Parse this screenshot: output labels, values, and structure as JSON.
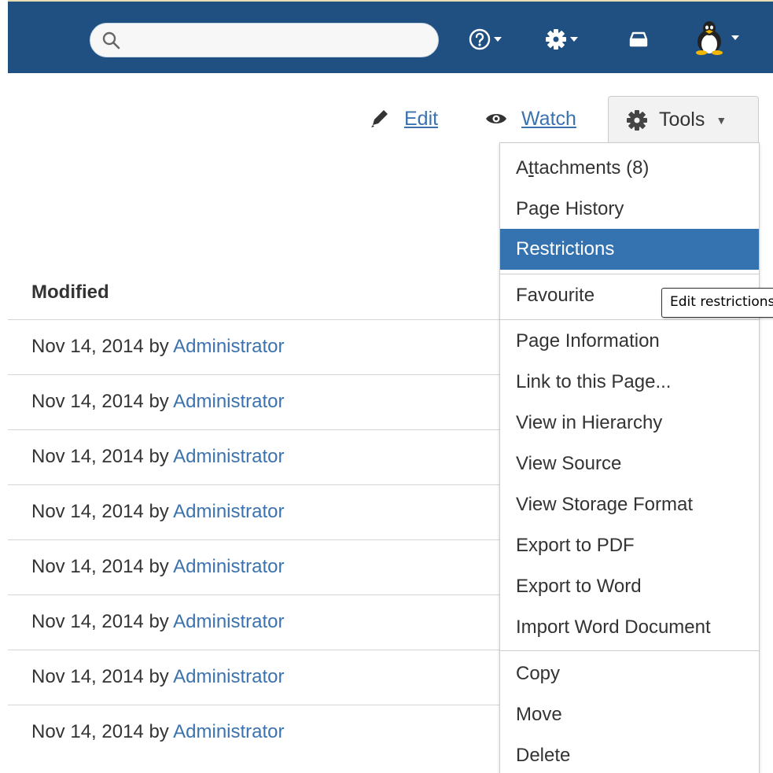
{
  "header": {
    "search": {
      "value": "",
      "placeholder": ""
    },
    "icons": [
      "search-icon",
      "help-icon",
      "gear-icon",
      "inbox-icon",
      "user-avatar-icon"
    ],
    "background": "#205081"
  },
  "toolbar": {
    "edit_label": "Edit",
    "watch_label": "Watch",
    "tools_label": "Tools"
  },
  "table": {
    "header": "Modified",
    "rows": [
      {
        "date": "Nov 14, 2014 by ",
        "author": "Administrator"
      },
      {
        "date": "Nov 14, 2014 by ",
        "author": "Administrator"
      },
      {
        "date": "Nov 14, 2014 by ",
        "author": "Administrator"
      },
      {
        "date": "Nov 14, 2014 by ",
        "author": "Administrator"
      },
      {
        "date": "Nov 14, 2014 by ",
        "author": "Administrator"
      },
      {
        "date": "Nov 14, 2014 by ",
        "author": "Administrator"
      },
      {
        "date": "Nov 14, 2014 by ",
        "author": "Administrator"
      },
      {
        "date": "Nov 14, 2014 by ",
        "author": "Administrator"
      }
    ]
  },
  "tools_menu": {
    "attachments": {
      "pre": "A",
      "accel": "t",
      "post": "tachments (8)"
    },
    "page_history": "Page History",
    "restrictions": "Restrictions",
    "favourite": "Favourite",
    "page_information": "Page Information",
    "link_to_page": "Link to this Page...",
    "view_hierarchy": "View in Hierarchy",
    "view_source": "View Source",
    "view_storage_format": "View Storage Format",
    "export_pdf": "Export to PDF",
    "export_word": "Export to Word",
    "import_word": "Import Word Document",
    "copy": "Copy",
    "move": "Move",
    "delete": "Delete",
    "active_item": "Restrictions"
  },
  "tooltip": "Edit restrictions",
  "colors": {
    "link": "#3b73af",
    "active": "#3572b0"
  }
}
